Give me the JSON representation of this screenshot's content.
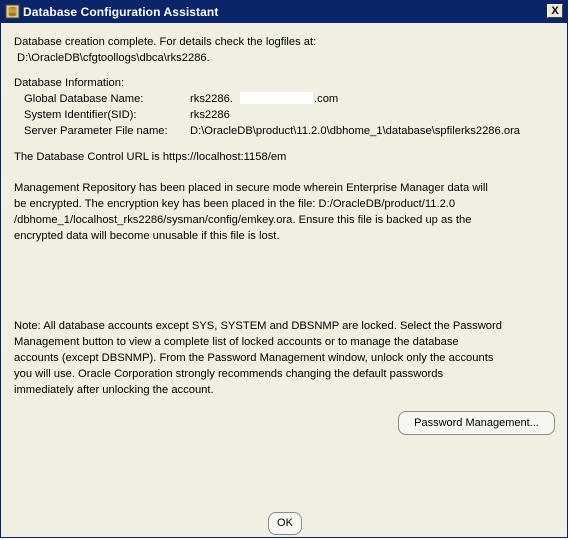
{
  "window": {
    "title": "Database Configuration Assistant",
    "icon": "dbca-app-icon",
    "close_label": "X"
  },
  "content": {
    "creation_line1": "Database creation complete. For details check the logfiles at:",
    "creation_line2": "D:\\OracleDB\\cfgtoollogs\\dbca\\rks2286.",
    "info_header": "Database Information:",
    "info": {
      "global_name_label": "Global Database Name:",
      "global_name_value_prefix": "rks2286.",
      "global_name_value_suffix": ".com",
      "sid_label": "System Identifier(SID):",
      "sid_value": "rks2286",
      "spfile_label": "Server Parameter File name:",
      "spfile_value": "D:\\OracleDB\\product\\11.2.0\\dbhome_1\\database\\spfilerks2286.ora"
    },
    "control_url_line": "The Database Control URL is https://localhost:1158/em",
    "repository_lines": [
      "Management Repository has been placed in secure mode wherein Enterprise Manager data will",
      "be encrypted.  The encryption key has been placed in the file: D:/OracleDB/product/11.2.0",
      "/dbhome_1/localhost_rks2286/sysman/config/emkey.ora. Ensure this file is backed up as the",
      "encrypted data will become unusable if this file is lost."
    ],
    "note_lines": [
      "Note: All database accounts except SYS, SYSTEM and DBSNMP are locked. Select the Password",
      "Management button to view a complete list of locked accounts or to manage the database",
      "accounts (except DBSNMP). From the Password Management window, unlock only the accounts",
      "you will use. Oracle Corporation strongly recommends changing the default passwords",
      "immediately after unlocking the account."
    ]
  },
  "buttons": {
    "password_management": "Password Management...",
    "ok": "OK"
  },
  "colors": {
    "titlebar": "#0a246a",
    "dialog_background": "#f0efe1",
    "redaction": "#ffffff"
  }
}
